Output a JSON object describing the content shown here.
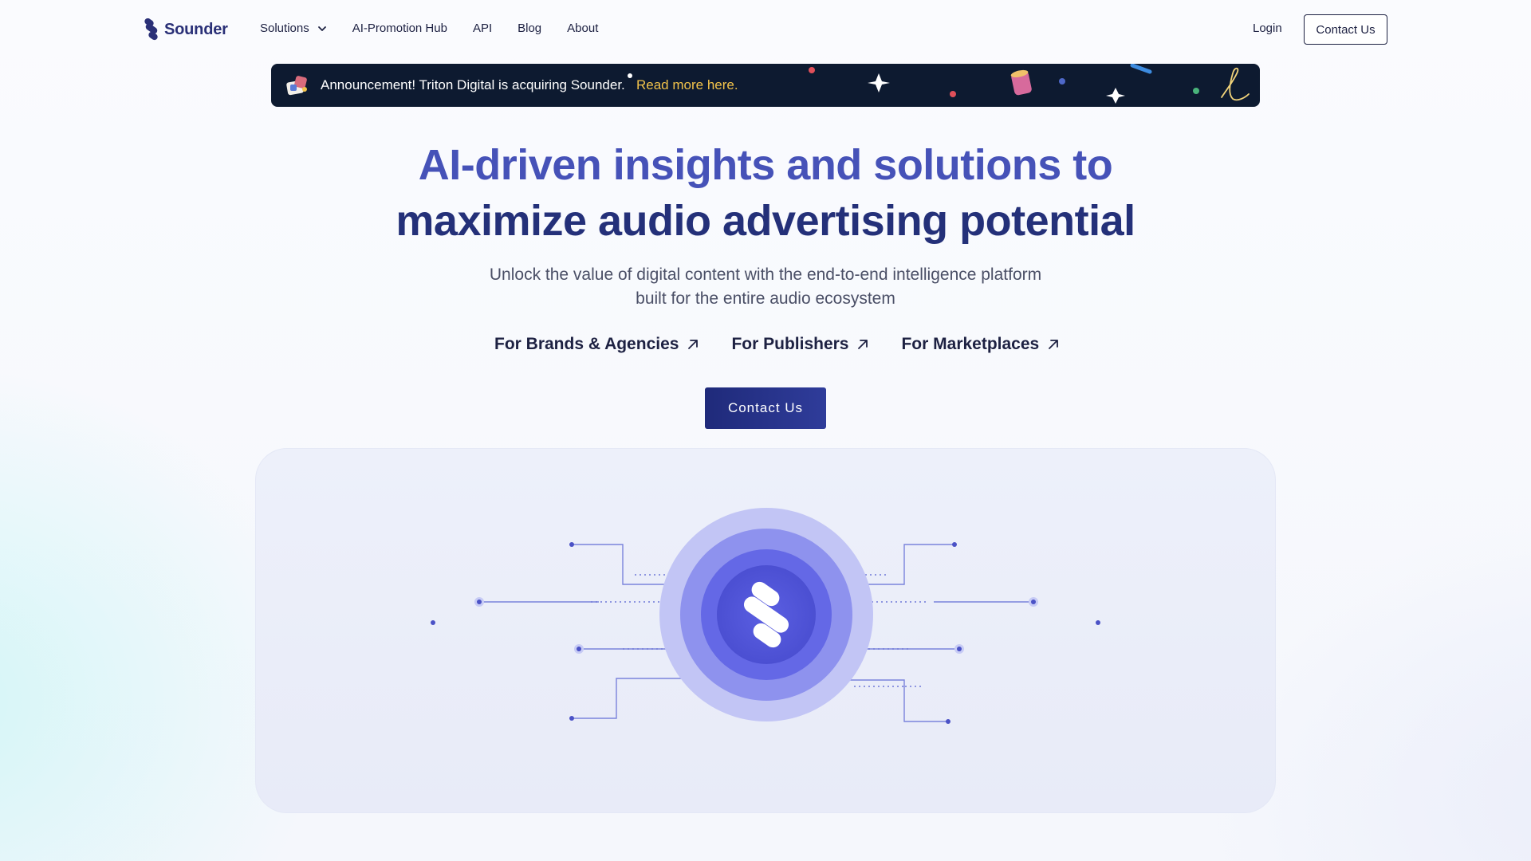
{
  "nav": {
    "brand": "Sounder",
    "links": [
      {
        "label": "Solutions",
        "has_dropdown": true
      },
      {
        "label": "AI-Promotion Hub"
      },
      {
        "label": "API"
      },
      {
        "label": "Blog"
      },
      {
        "label": "About"
      }
    ],
    "login_label": "Login",
    "contact_label": "Contact Us"
  },
  "announcement": {
    "text": "Announcement! Triton Digital is acquiring Sounder.",
    "link_label": "Read more here.",
    "background_color": "#0d1a30",
    "link_color": "#f1c24a"
  },
  "hero": {
    "title_line1": "AI-driven insights and solutions to",
    "title_line2": "maximize audio advertising potential",
    "subtitle_line1": "Unlock the value of digital content with the end-to-end intelligence platform",
    "subtitle_line2": "built for the entire audio ecosystem",
    "audience_links": [
      {
        "label": "For Brands & Agencies",
        "icon": "arrow-up-right-icon"
      },
      {
        "label": "For Publishers",
        "icon": "arrow-up-right-icon"
      },
      {
        "label": "For Marketplaces",
        "icon": "arrow-up-right-icon"
      }
    ],
    "cta_label": "Contact Us",
    "cta_color": "#243079"
  },
  "colors": {
    "brand_primary": "#243079",
    "brand_accent": "#4652b8",
    "circuit_line": "#6f78d8"
  }
}
